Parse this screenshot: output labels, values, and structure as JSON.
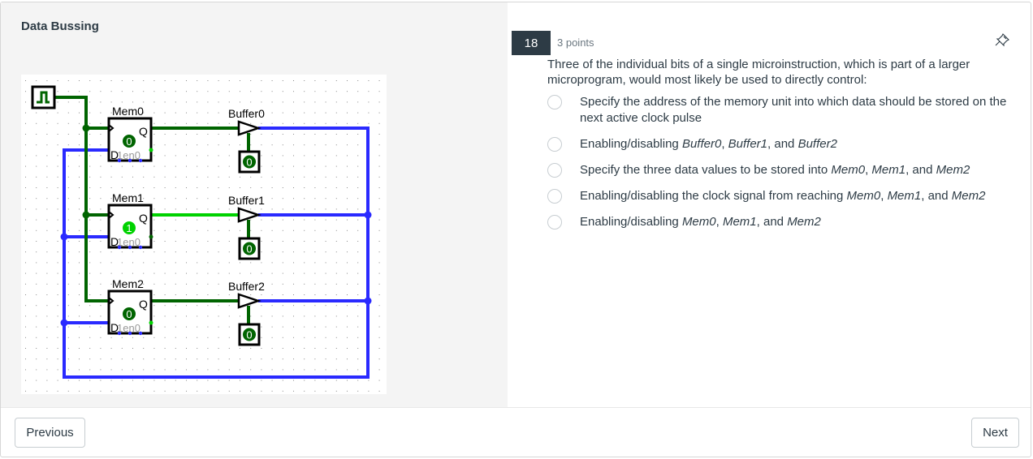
{
  "left_panel": {
    "title": "Data Bussing",
    "circuit": {
      "clock_label": "clock",
      "memories": [
        {
          "name": "Mem0",
          "value": "0",
          "active": false,
          "pin_d": "D",
          "pin_q": "Q",
          "pin_en_text": "1en0"
        },
        {
          "name": "Mem1",
          "value": "1",
          "active": true,
          "pin_d": "D",
          "pin_q": "Q",
          "pin_en_text": "1en0"
        },
        {
          "name": "Mem2",
          "value": "0",
          "active": false,
          "pin_d": "D",
          "pin_q": "Q",
          "pin_en_text": "1en0"
        }
      ],
      "buffers": [
        {
          "name": "Buffer0",
          "enable_value": "0"
        },
        {
          "name": "Buffer1",
          "enable_value": "0"
        },
        {
          "name": "Buffer2",
          "enable_value": "0"
        }
      ],
      "colors": {
        "wire_low": "#006400",
        "wire_high": "#00d200",
        "bus": "#2a2aff",
        "component": "#000000"
      }
    }
  },
  "question": {
    "number": "18",
    "points": "3 points",
    "text": "Three of the individual bits of a single microinstruction, which is part of a larger microprogram, would most likely be used to directly control:",
    "options": [
      {
        "parts": [
          {
            "t": "Specify the address of the memory unit into which data should be stored on the next active clock pulse",
            "i": false
          }
        ],
        "selected": false
      },
      {
        "parts": [
          {
            "t": "Enabling/disabling ",
            "i": false
          },
          {
            "t": "Buffer0",
            "i": true
          },
          {
            "t": ", ",
            "i": false
          },
          {
            "t": "Buffer1",
            "i": true
          },
          {
            "t": ", and ",
            "i": false
          },
          {
            "t": "Buffer2",
            "i": true
          }
        ],
        "selected": false
      },
      {
        "parts": [
          {
            "t": "Specify the three data values to be stored into ",
            "i": false
          },
          {
            "t": "Mem0",
            "i": true
          },
          {
            "t": ", ",
            "i": false
          },
          {
            "t": "Mem1",
            "i": true
          },
          {
            "t": ", and ",
            "i": false
          },
          {
            "t": "Mem2",
            "i": true
          }
        ],
        "selected": false
      },
      {
        "parts": [
          {
            "t": "Enabling/disabling the clock signal from reaching ",
            "i": false
          },
          {
            "t": "Mem0",
            "i": true
          },
          {
            "t": ", ",
            "i": false
          },
          {
            "t": "Mem1",
            "i": true
          },
          {
            "t": ", and ",
            "i": false
          },
          {
            "t": "Mem2",
            "i": true
          }
        ],
        "selected": false
      },
      {
        "parts": [
          {
            "t": "Enabling/disabling ",
            "i": false
          },
          {
            "t": "Mem0",
            "i": true
          },
          {
            "t": ", ",
            "i": false
          },
          {
            "t": "Mem1",
            "i": true
          },
          {
            "t": ", and ",
            "i": false
          },
          {
            "t": "Mem2",
            "i": true
          }
        ],
        "selected": false
      }
    ],
    "header_color": "#2d3b45"
  },
  "navigation": {
    "previous_label": "Previous",
    "next_label": "Next"
  }
}
